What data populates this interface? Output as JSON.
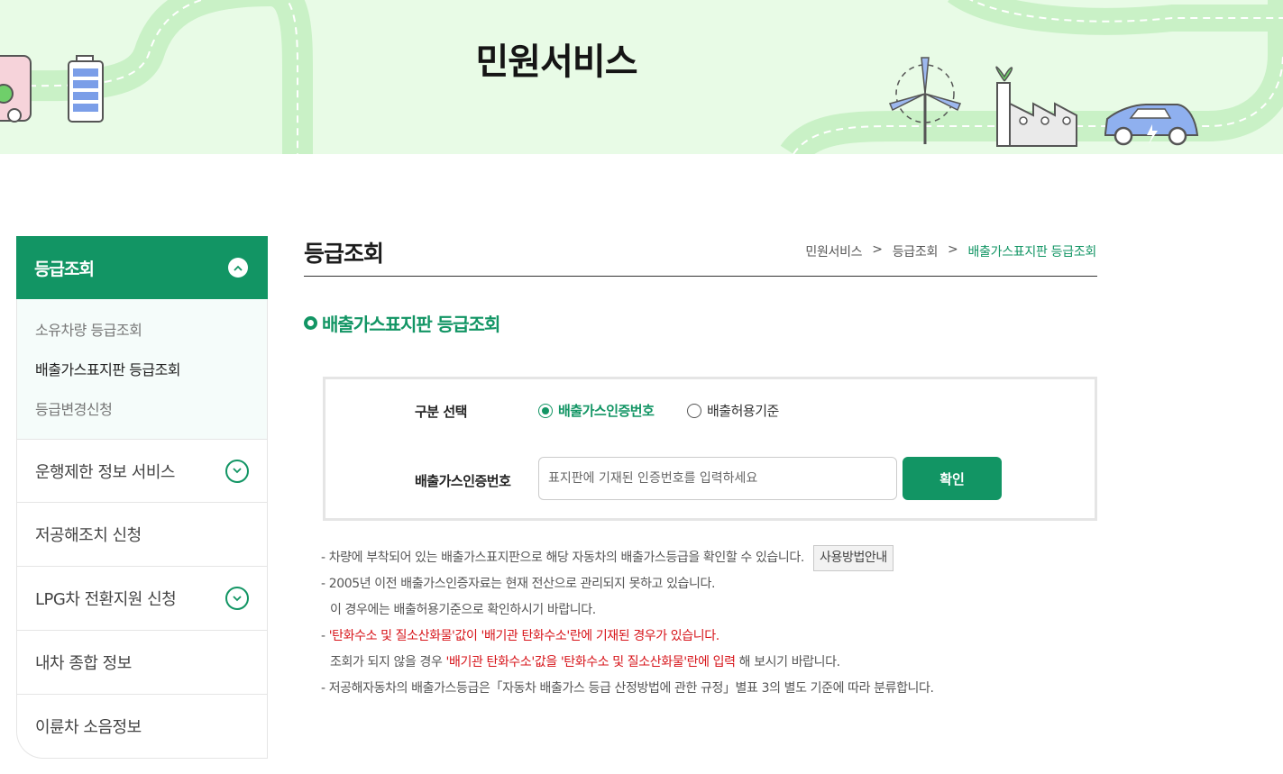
{
  "banner": {
    "title": "민원서비스"
  },
  "sidebar": {
    "header": "등급조회",
    "sub_items": [
      "소유차량 등급조회",
      "배출가스표지판 등급조회",
      "등급변경신청"
    ],
    "menu_items": [
      {
        "label": "운행제한 정보 서비스",
        "expandable": true
      },
      {
        "label": "저공해조치 신청",
        "expandable": false
      },
      {
        "label": "LPG차 전환지원 신청",
        "expandable": true
      },
      {
        "label": "내차 종합 정보",
        "expandable": false
      },
      {
        "label": "이륜차 소음정보",
        "expandable": false
      }
    ]
  },
  "page": {
    "title": "등급조회",
    "breadcrumb": [
      "민원서비스",
      "등급조회",
      "배출가스표지판 등급조회"
    ],
    "breadcrumb_sep": ">",
    "section_title": "배출가스표지판 등급조회"
  },
  "form": {
    "select_label": "구분 선택",
    "radio_options": [
      {
        "label": "배출가스인증번호",
        "checked": true
      },
      {
        "label": "배출허용기준",
        "checked": false
      }
    ],
    "field_label": "배출가스인증번호",
    "placeholder": "표지판에 기재된 인증번호를 입력하세요",
    "value": "",
    "submit_label": "확인"
  },
  "notes": {
    "line1": "- 차량에 부착되어 있는 배출가스표지판으로 해당 자동차의 배출가스등급을 확인할 수 있습니다.",
    "guide_button": "사용방법안내",
    "line2": "- 2005년 이전 배출가스인증자료는 현재 전산으로 관리되지 못하고 있습니다.",
    "line3": "이 경우에는 배출허용기준으로 확인하시기 바랍니다.",
    "line4_prefix": "- ",
    "line4_red": "'탄화수소 및 질소산화물'값이 '배기관 탄화수소'란에 기재된 경우가 있습니다.",
    "line5_a": "조회가 되지 않을 경우 ",
    "line5_red": "'배기관 탄화수소'값을 '탄화수소 및 질소산화물'란에 입력",
    "line5_b": " 해 보시기 바랍니다.",
    "line6": "- 저공해자동차의 배출가스등급은「자동차 배출가스 등급 산정방법에 관한 규정」별표 3의 별도 기준에 따라 분류합니다."
  },
  "colors": {
    "primary": "#129564",
    "banner_bg": "#e8fbe6",
    "warning": "#d7141a"
  }
}
